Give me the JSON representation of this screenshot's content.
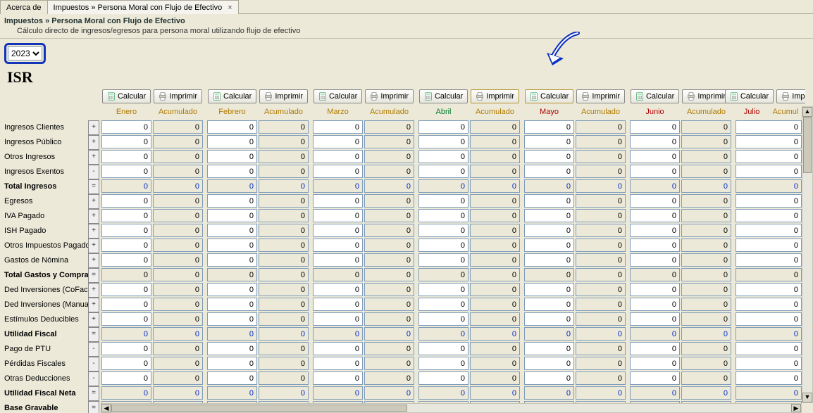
{
  "tabs": {
    "about": "Acerca de",
    "main": "Impuestos » Persona Moral con Flujo de Efectivo",
    "close": "×"
  },
  "header": {
    "title": "Impuestos » Persona Moral con Flujo de Efectivo",
    "subtitle": "Cálculo directo de ingresos/egresos para persona moral utilizando flujo de efectivo"
  },
  "year": "2023",
  "section": "ISR",
  "buttons": {
    "calc": "Calcular",
    "print": "Imprimir",
    "print_short": "Impr"
  },
  "col_ac": "Acumulado",
  "col_ac_short": "Acumul",
  "months": [
    {
      "name": "Enero",
      "color": "default"
    },
    {
      "name": "Febrero",
      "color": "default"
    },
    {
      "name": "Marzo",
      "color": "default"
    },
    {
      "name": "Abril",
      "color": "green"
    },
    {
      "name": "Mayo",
      "color": "red"
    },
    {
      "name": "Junio",
      "color": "red"
    },
    {
      "name": "Julio",
      "color": "red"
    }
  ],
  "rows": [
    {
      "label": "Ingresos Clientes",
      "op": "+",
      "bold": false,
      "editable": true,
      "blue": false
    },
    {
      "label": "Ingresos Público",
      "op": "+",
      "bold": false,
      "editable": true,
      "blue": false
    },
    {
      "label": "Otros Ingresos",
      "op": "+",
      "bold": false,
      "editable": true,
      "blue": false
    },
    {
      "label": "Ingresos Exentos",
      "op": "-",
      "bold": false,
      "editable": true,
      "blue": false
    },
    {
      "label": "Total Ingresos",
      "op": "=",
      "bold": true,
      "editable": false,
      "blue": true
    },
    {
      "label": "Egresos",
      "op": "+",
      "bold": false,
      "editable": true,
      "blue": false
    },
    {
      "label": "IVA Pagado",
      "op": "+",
      "bold": false,
      "editable": true,
      "blue": false
    },
    {
      "label": "ISH Pagado",
      "op": "+",
      "bold": false,
      "editable": true,
      "blue": false
    },
    {
      "label": "Otros Impuestos Pagado",
      "op": "+",
      "bold": false,
      "editable": true,
      "blue": false
    },
    {
      "label": "Gastos de Nómina",
      "op": "+",
      "bold": false,
      "editable": true,
      "blue": false
    },
    {
      "label": "Total Gastos y Compras",
      "op": "=",
      "bold": true,
      "editable": false,
      "blue": false
    },
    {
      "label": "Ded Inversiones (CoFac)",
      "op": "+",
      "bold": false,
      "editable": true,
      "blue": false
    },
    {
      "label": "Ded Inversiones (Manual)",
      "op": "+",
      "bold": false,
      "editable": true,
      "blue": false
    },
    {
      "label": "Estímulos Deducibles",
      "op": "+",
      "bold": false,
      "editable": true,
      "blue": false
    },
    {
      "label": "Utilidad Fiscal",
      "op": "=",
      "bold": true,
      "editable": false,
      "blue": true
    },
    {
      "label": "Pago de PTU",
      "op": "-",
      "bold": false,
      "editable": true,
      "blue": false
    },
    {
      "label": "Pérdidas Fiscales",
      "op": "-",
      "bold": false,
      "editable": true,
      "blue": false
    },
    {
      "label": "Otras Deducciones",
      "op": "-",
      "bold": false,
      "editable": true,
      "blue": false
    },
    {
      "label": "Utilidad Fiscal Neta",
      "op": "=",
      "bold": true,
      "editable": false,
      "blue": true
    },
    {
      "label": "Base Gravable",
      "op": "=",
      "bold": true,
      "editable": false,
      "blue": false
    }
  ],
  "cell_value": "0"
}
